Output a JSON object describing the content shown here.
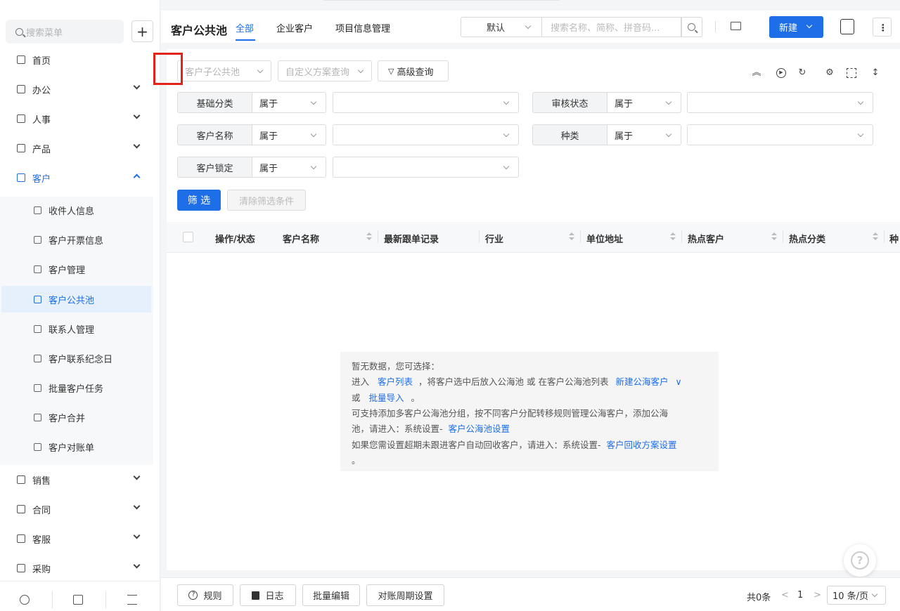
{
  "sidebar": {
    "search_placeholder": "搜索菜单",
    "add_label": "+",
    "menu": [
      {
        "label": "首页"
      },
      {
        "label": "办公"
      },
      {
        "label": "人事"
      },
      {
        "label": "产品"
      },
      {
        "label": "客户"
      },
      {
        "label": "销售"
      },
      {
        "label": "合同"
      },
      {
        "label": "客服"
      },
      {
        "label": "采购"
      }
    ],
    "submenu": [
      {
        "label": "收件人信息"
      },
      {
        "label": "客户开票信息"
      },
      {
        "label": "客户管理"
      },
      {
        "label": "客户公共池"
      },
      {
        "label": "联系人管理"
      },
      {
        "label": "客户联系纪念日"
      },
      {
        "label": "批量客户任务"
      },
      {
        "label": "客户合并"
      },
      {
        "label": "客户对账单"
      }
    ]
  },
  "header": {
    "title": "客户公共池",
    "tabs": [
      {
        "label": "全部"
      },
      {
        "label": "企业客户"
      },
      {
        "label": "项目信息管理"
      }
    ],
    "view_select": "默认",
    "search_placeholder": "搜索名称、简称、拼音码...",
    "new_label": "新建"
  },
  "toolbar": {
    "pool_select": "客户子公共池",
    "scheme_select": "自定义方案查询",
    "advanced_label": "高级查询"
  },
  "filters": [
    {
      "label": "基础分类",
      "op": "属于"
    },
    {
      "label": "审核状态",
      "op": "属于"
    },
    {
      "label": "客户名称",
      "op": "属于"
    },
    {
      "label": "种类",
      "op": "属于"
    },
    {
      "label": "客户锁定",
      "op": "属于"
    }
  ],
  "filter_actions": {
    "apply_label": "筛 选",
    "clear_label": "清除筛选条件"
  },
  "table": {
    "columns": [
      "操作/状态",
      "客户名称",
      "最新跟单记录",
      "行业",
      "单位地址",
      "热点客户",
      "热点分类",
      "种"
    ]
  },
  "empty": {
    "line1": "暂无数据，您可选择：",
    "l2_a": "进入",
    "l2_link1": "客户列表",
    "l2_b": "，将客户选中后放入公海池 或 在客户公海池列表",
    "l2_link2": "新建公海客户",
    "l3_a": "或",
    "l3_link": "批量导入",
    "l3_b": "。",
    "line4": "可支持添加多客户公海池分组，按不同客户分配转移规则管理公海客户，添加公海",
    "l5_a": "池，请进入：系统设置-",
    "l5_link": "客户公海池设置",
    "l6_a": "如果您需设置超期未跟进客户自动回收客户，请进入：系统设置-",
    "l6_link": "客户回收方案设置",
    "line7": "。"
  },
  "footer": {
    "buttons": [
      {
        "label": "规则"
      },
      {
        "label": "日志"
      },
      {
        "label": "批量编辑"
      },
      {
        "label": "对账周期设置"
      }
    ],
    "total": "共0条",
    "prev": "<",
    "page": "1",
    "next": ">",
    "page_size": "10 条/页"
  },
  "help_label": "?",
  "colors": {
    "accent": "#1e6ee8",
    "highlight_box": "#e2231a"
  }
}
